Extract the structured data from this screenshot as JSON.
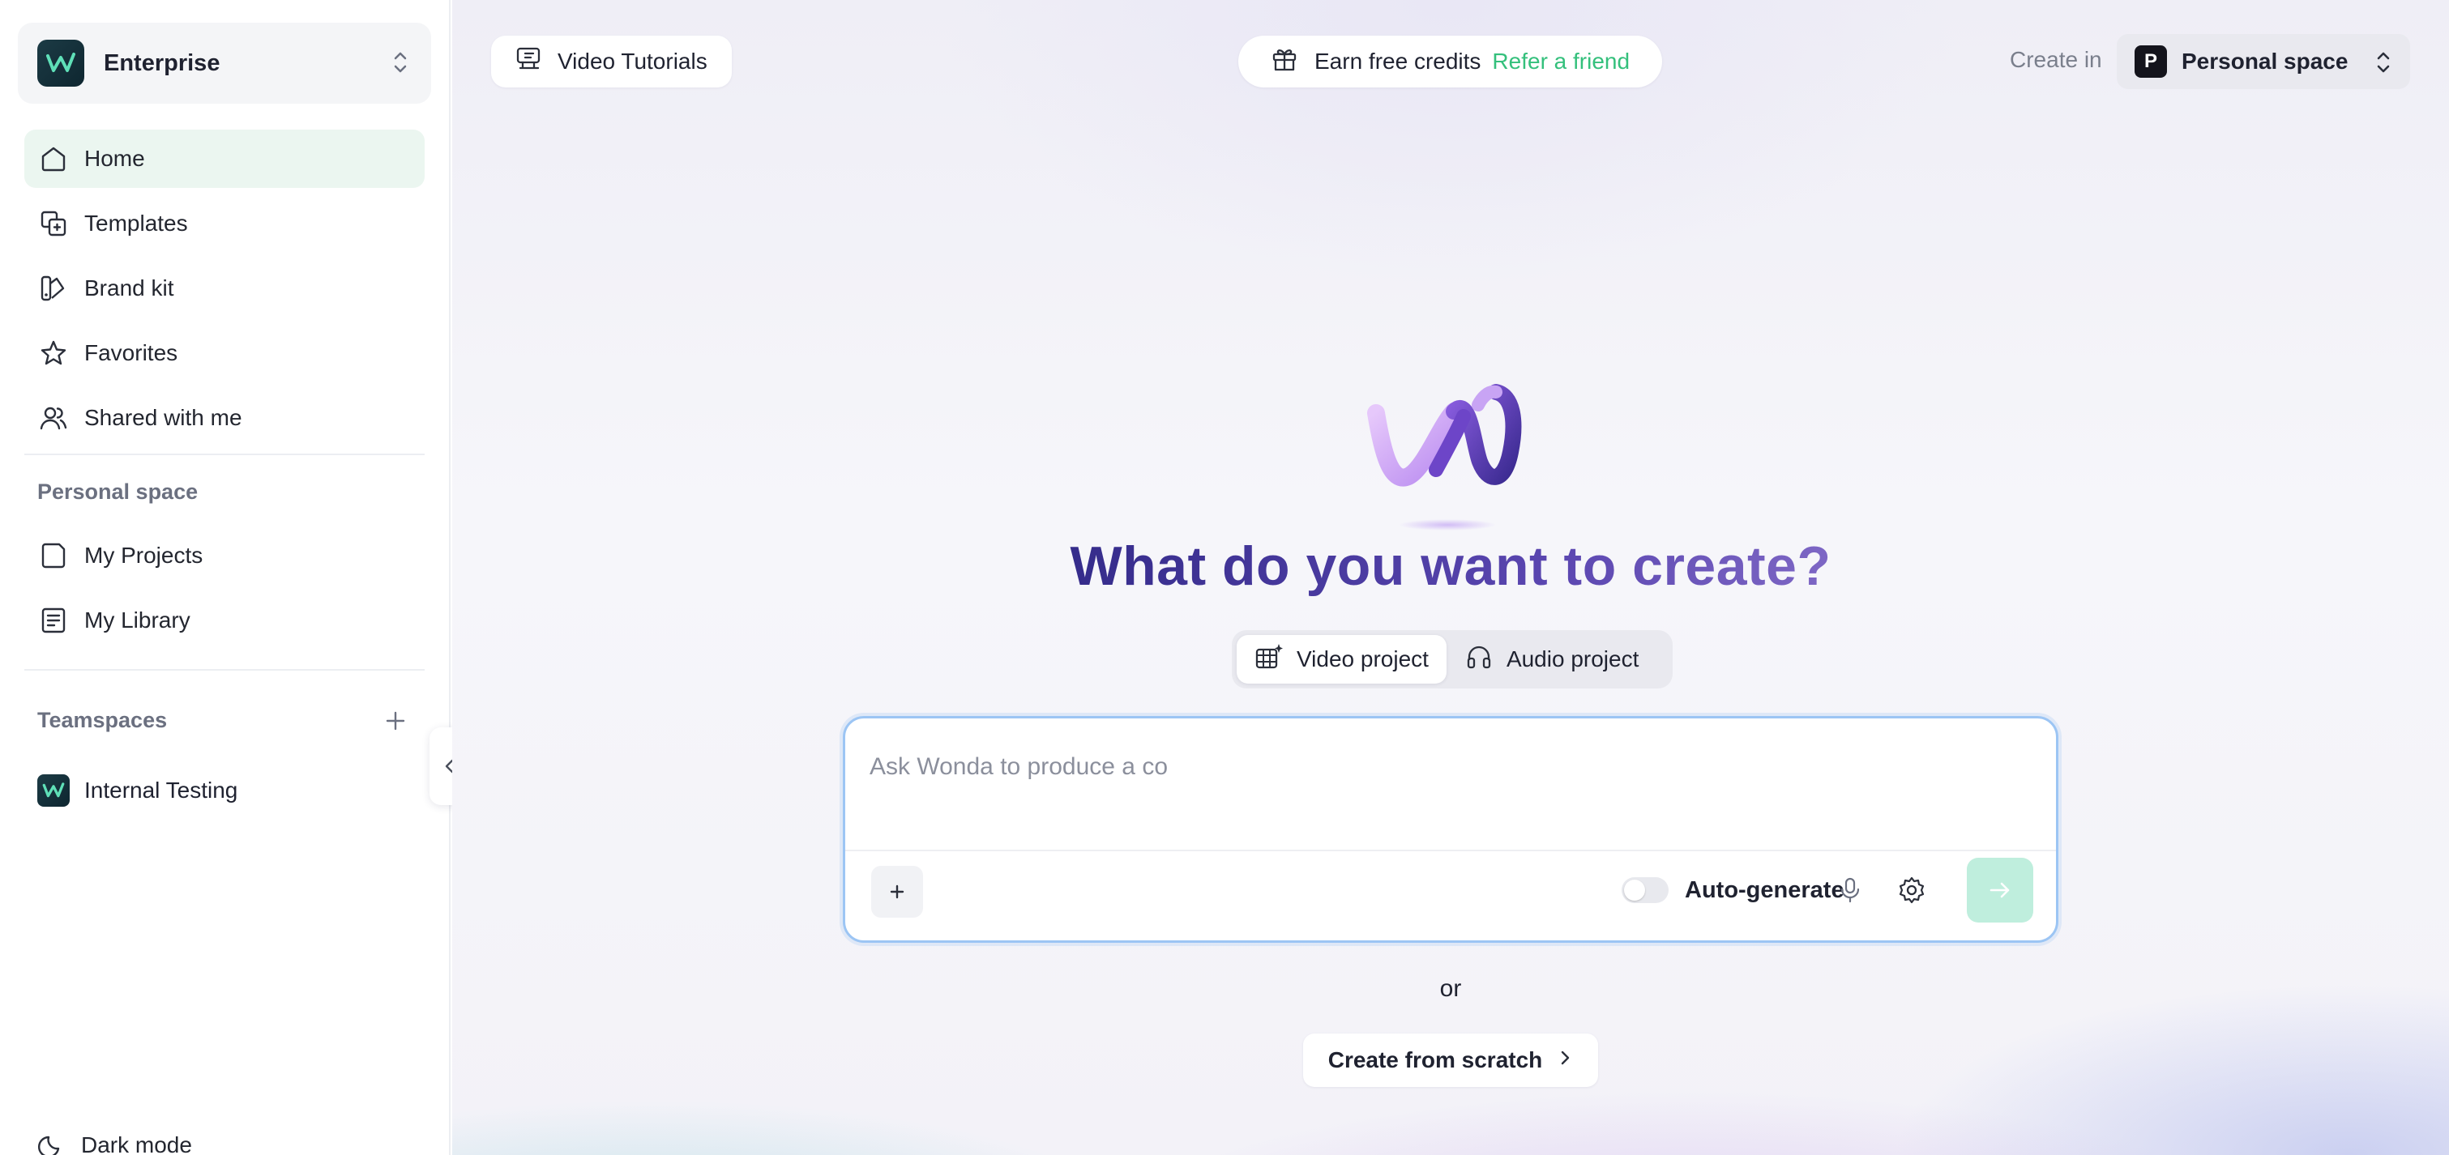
{
  "sidebar": {
    "workspace_name": "Enterprise",
    "nav_items": [
      {
        "label": "Home",
        "icon": "home-icon",
        "active": true
      },
      {
        "label": "Templates",
        "icon": "templates-icon"
      },
      {
        "label": "Brand kit",
        "icon": "brand-kit-icon"
      },
      {
        "label": "Favorites",
        "icon": "star-icon"
      },
      {
        "label": "Shared with me",
        "icon": "users-icon"
      }
    ],
    "personal_section_label": "Personal space",
    "personal_items": [
      {
        "label": "My Projects",
        "icon": "folder-icon"
      },
      {
        "label": "My Library",
        "icon": "library-icon"
      }
    ],
    "teamspaces_label": "Teamspaces",
    "team_items": [
      {
        "label": "Internal Testing"
      }
    ],
    "dark_mode_label": "Dark mode"
  },
  "header": {
    "tutorials_label": "Video Tutorials",
    "credits_label": "Earn free credits",
    "refer_label": "Refer a friend",
    "create_in_label": "Create in",
    "space_badge": "P",
    "space_label": "Personal space"
  },
  "hero": {
    "title": "What do you want to create?",
    "tabs": [
      {
        "label": "Video project",
        "selected": true
      },
      {
        "label": "Audio project",
        "selected": false
      }
    ]
  },
  "prompt": {
    "value": "",
    "placeholder": "Ask Wonda to produce a co",
    "auto_generate_label": "Auto-generate",
    "auto_generate_on": false
  },
  "footer": {
    "or_label": "or",
    "scratch_label": "Create from scratch"
  },
  "colors": {
    "accent_green": "#34c07c",
    "active_nav_bg": "#ebf6f0",
    "send_button_bg": "#bfeedd",
    "title_dark": "#24207a",
    "title_light": "#a68cdc"
  }
}
